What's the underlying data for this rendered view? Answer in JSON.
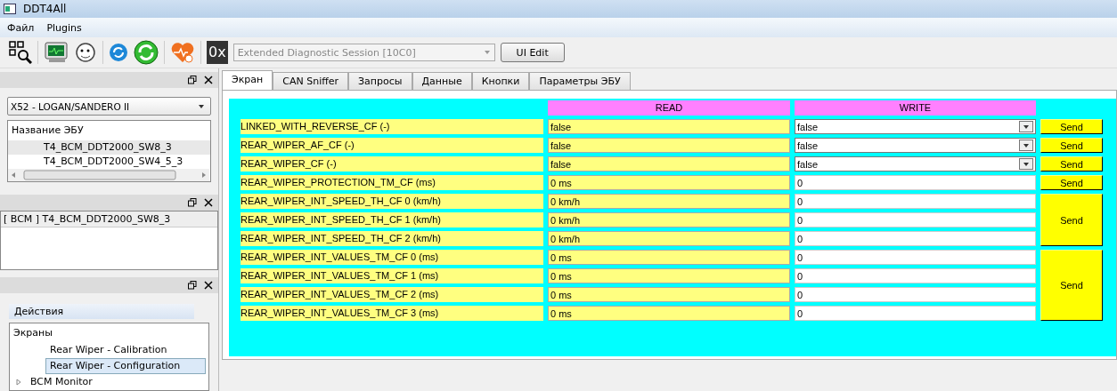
{
  "window": {
    "title": "DDT4All"
  },
  "menu": [
    {
      "label": "Файл"
    },
    {
      "label": "Plugins"
    }
  ],
  "toolbar": {
    "hex_label": "0x",
    "session_select": {
      "value": "Extended Diagnostic Session [10C0]",
      "disabled": true
    },
    "ui_edit_button": "UI Edit"
  },
  "vehicle_select": {
    "value": "X52 - LOGAN/SANDERO II"
  },
  "ecu_list": {
    "header": "Название ЭБУ",
    "items": [
      {
        "label": "T4_BCM_DDT2000_SW8_3",
        "selected": true
      },
      {
        "label": "T4_BCM_DDT2000_SW4_5_3",
        "selected": false
      }
    ]
  },
  "ecu_panel": {
    "items": [
      {
        "label": "[ BCM ] T4_BCM_DDT2000_SW8_3",
        "selected": true
      }
    ]
  },
  "actions_panel": {
    "group_title": "Действия",
    "tree_header": "Экраны",
    "items": [
      {
        "label": "Rear Wiper - Calibration",
        "selected": false
      },
      {
        "label": "Rear Wiper - Configuration",
        "selected": true
      },
      {
        "label": "BCM Monitor",
        "selected": false,
        "expanded": false
      }
    ]
  },
  "tabs": [
    {
      "label": "Экран",
      "selected": true
    },
    {
      "label": "CAN Sniffer",
      "selected": false
    },
    {
      "label": "Запросы",
      "selected": false
    },
    {
      "label": "Данные",
      "selected": false
    },
    {
      "label": "Кнопки",
      "selected": false
    },
    {
      "label": "Параметры ЭБУ",
      "selected": false
    }
  ],
  "screen": {
    "read_header": "READ",
    "write_header": "WRITE",
    "groups": [
      {
        "send": "Send",
        "rows": [
          {
            "label": "LINKED_WITH_REVERSE_CF (-)",
            "read": "false",
            "write": {
              "kind": "select",
              "value": "false"
            }
          }
        ]
      },
      {
        "send": "Send",
        "rows": [
          {
            "label": "REAR_WIPER_AF_CF (-)",
            "read": "false",
            "write": {
              "kind": "select",
              "value": "false"
            }
          }
        ]
      },
      {
        "send": "Send",
        "rows": [
          {
            "label": "REAR_WIPER_CF (-)",
            "read": "false",
            "write": {
              "kind": "select",
              "value": "false"
            }
          }
        ]
      },
      {
        "send": "Send",
        "rows": [
          {
            "label": "REAR_WIPER_PROTECTION_TM_CF (ms)",
            "read": "0 ms",
            "write": {
              "kind": "input",
              "value": "0"
            }
          }
        ]
      },
      {
        "send": "Send",
        "rows": [
          {
            "label": "REAR_WIPER_INT_SPEED_TH_CF 0 (km/h)",
            "read": "0 km/h",
            "write": {
              "kind": "input",
              "value": "0"
            }
          },
          {
            "label": "REAR_WIPER_INT_SPEED_TH_CF 1 (km/h)",
            "read": "0 km/h",
            "write": {
              "kind": "input",
              "value": "0"
            }
          },
          {
            "label": "REAR_WIPER_INT_SPEED_TH_CF 2 (km/h)",
            "read": "0 km/h",
            "write": {
              "kind": "input",
              "value": "0"
            }
          }
        ]
      },
      {
        "send": "Send",
        "rows": [
          {
            "label": "REAR_WIPER_INT_VALUES_TM_CF 0 (ms)",
            "read": "0 ms",
            "write": {
              "kind": "input",
              "value": "0"
            }
          },
          {
            "label": "REAR_WIPER_INT_VALUES_TM_CF 1 (ms)",
            "read": "0 ms",
            "write": {
              "kind": "input",
              "value": "0"
            }
          },
          {
            "label": "REAR_WIPER_INT_VALUES_TM_CF 2 (ms)",
            "read": "0 ms",
            "write": {
              "kind": "input",
              "value": "0"
            }
          },
          {
            "label": "REAR_WIPER_INT_VALUES_TM_CF 3 (ms)",
            "read": "0 ms",
            "write": {
              "kind": "input",
              "value": "0"
            }
          }
        ]
      }
    ]
  }
}
